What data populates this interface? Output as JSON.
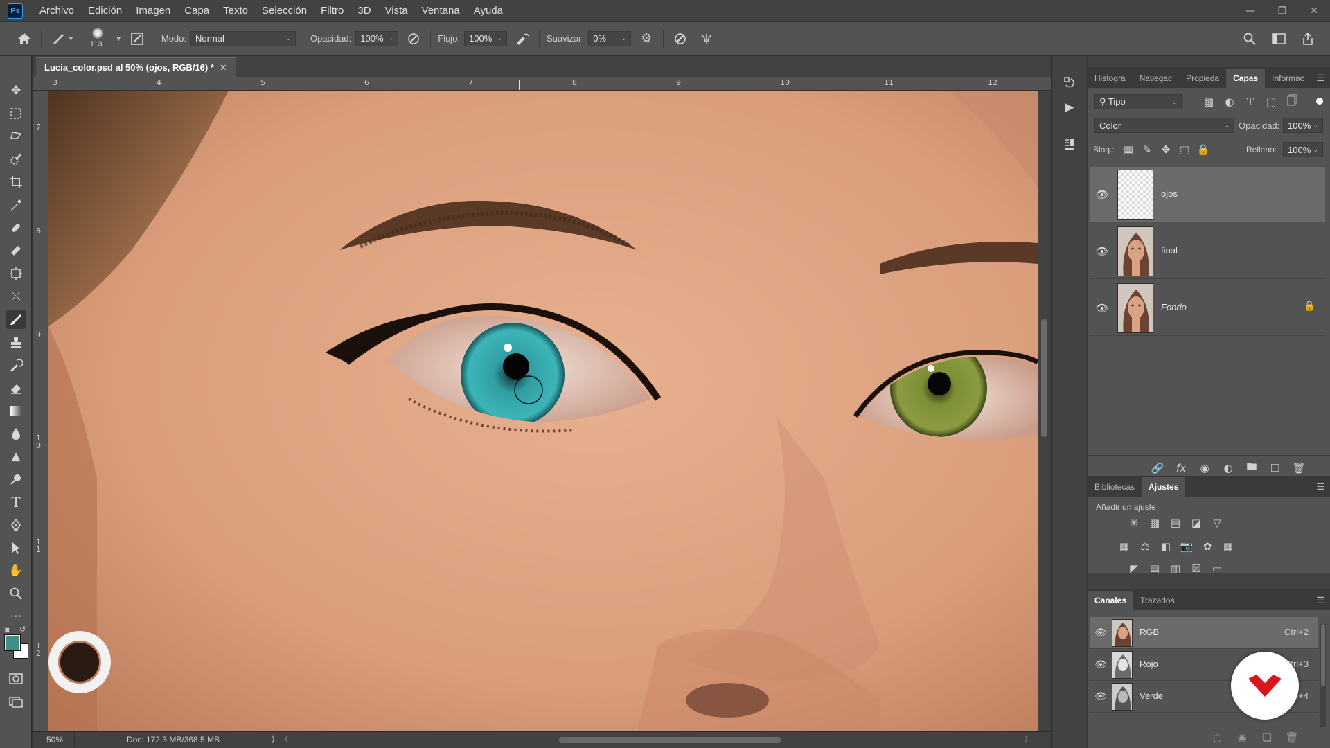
{
  "app": {
    "logo_text": "Ps",
    "menu": [
      "Archivo",
      "Edición",
      "Imagen",
      "Capa",
      "Texto",
      "Selección",
      "Filtro",
      "3D",
      "Vista",
      "Ventana",
      "Ayuda"
    ]
  },
  "options": {
    "brush_size": "113",
    "mode_label": "Modo:",
    "mode_value": "Normal",
    "opacity_label": "Opacidad:",
    "opacity_value": "100%",
    "flow_label": "Flujo:",
    "flow_value": "100%",
    "smoothing_label": "Suavizar:",
    "smoothing_value": "0%"
  },
  "document": {
    "tab_title": "Lucia_color.psd al 50% (ojos, RGB/16) *",
    "zoom": "50%",
    "doc_info": "Doc: 172,3 MB/368,5 MB"
  },
  "rulers": {
    "top": [
      "3",
      "4",
      "5",
      "6",
      "7",
      "8",
      "9",
      "10",
      "11",
      "12"
    ],
    "left": [
      "7",
      "8",
      "9",
      "1\n0",
      "1\n1",
      "1\n2"
    ]
  },
  "layers_panel": {
    "tabs": [
      "Histogra",
      "Navegac",
      "Propieda",
      "Capas",
      "Informac"
    ],
    "active_tab": "Capas",
    "filter_value": "Tipo",
    "blend_mode": "Color",
    "opacity_label": "Opacidad:",
    "opacity_value": "100%",
    "lock_label": "Bloq.:",
    "fill_label": "Relleno:",
    "fill_value": "100%",
    "layers": [
      {
        "name": "ojos",
        "selected": true,
        "locked": false
      },
      {
        "name": "final",
        "selected": false,
        "locked": false
      },
      {
        "name": "Fondo",
        "selected": false,
        "locked": true
      }
    ]
  },
  "adjustments_panel": {
    "tabs": [
      "Bibliotecas",
      "Ajustes"
    ],
    "active_tab": "Ajustes",
    "heading": "Añadir un ajuste"
  },
  "channels_panel": {
    "tabs": [
      "Canales",
      "Trazados"
    ],
    "active_tab": "Canales",
    "channels": [
      {
        "name": "RGB",
        "shortcut": "Ctrl+2"
      },
      {
        "name": "Rojo",
        "shortcut": "Ctrl+3"
      },
      {
        "name": "Verde",
        "shortcut": "Ctrl+4"
      }
    ]
  },
  "colors": {
    "foreground": "#3f8f86",
    "background": "#ffffff",
    "left_iris": "#2f9ea3",
    "right_iris": "#7d8f35",
    "badge": "#d9151d"
  }
}
